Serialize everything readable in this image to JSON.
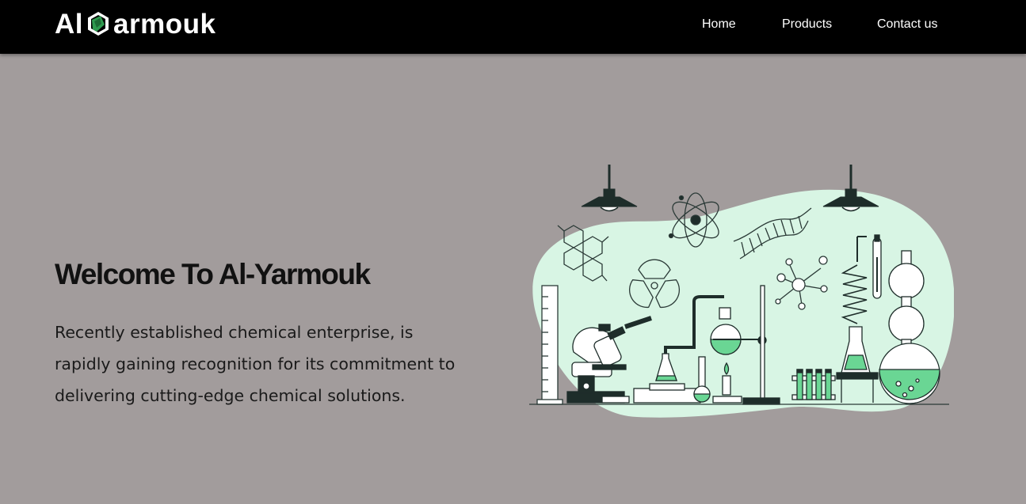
{
  "navbar": {
    "brand": {
      "prefix": "Al",
      "suffix": "armouk"
    },
    "links": [
      {
        "label": "Home"
      },
      {
        "label": "Products"
      },
      {
        "label": "Contact us"
      }
    ]
  },
  "hero": {
    "title": "Welcome To Al-Yarmouk",
    "description": "Recently established chemical enterprise, is rapidly gaining recognition for its commitment to delivering cutting-edge chemical solutions."
  },
  "colors": {
    "background": "#a29c9c",
    "navbar": "#000000",
    "accent_green": "#2f9a4f",
    "blob_mint": "#d8f5e4",
    "liquid_green": "#6ad694"
  },
  "icons": [
    "brand-logo-icon",
    "lab-illustration"
  ]
}
